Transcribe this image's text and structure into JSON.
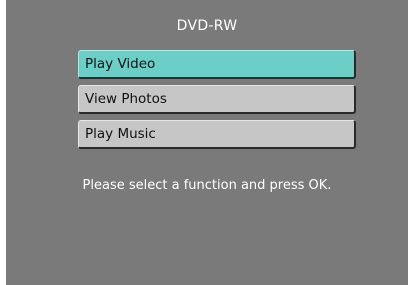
{
  "screen": {
    "title": "DVD-RW",
    "menu_items": [
      {
        "label": "Play Video",
        "selected": true
      },
      {
        "label": "View Photos",
        "selected": false
      },
      {
        "label": "Play Music",
        "selected": false
      }
    ],
    "hint": "Please select a function and press OK."
  },
  "colors": {
    "background": "#7a7a7a",
    "selected_item": "#6ccfc7",
    "item": "#c6c6c6",
    "text_light": "#ffffff",
    "text_dark": "#111111"
  }
}
